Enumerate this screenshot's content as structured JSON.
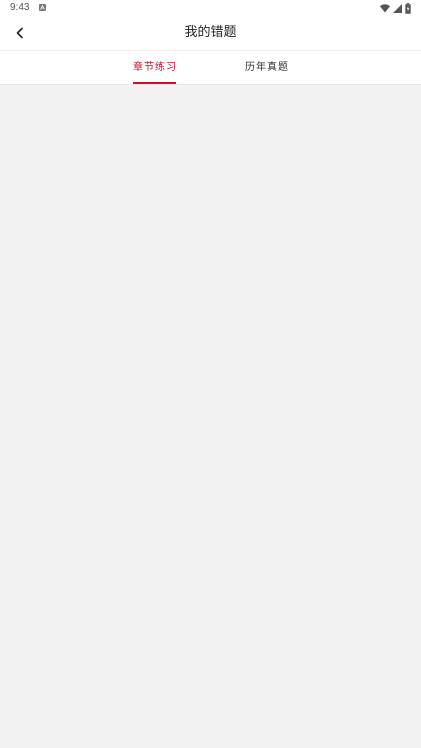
{
  "status_bar": {
    "time": "9:43",
    "icons": [
      "a-notification-icon",
      "wifi-icon",
      "signal-icon",
      "battery-icon"
    ]
  },
  "header": {
    "title": "我的错题",
    "back_icon": "chevron-left-icon"
  },
  "tabs": [
    {
      "label": "章节练习",
      "active": true
    },
    {
      "label": "历年真题",
      "active": false
    }
  ],
  "colors": {
    "accent": "#c8102e",
    "background": "#f2f2f2",
    "surface": "#ffffff",
    "text_primary": "#222222",
    "text_secondary": "#333333"
  }
}
